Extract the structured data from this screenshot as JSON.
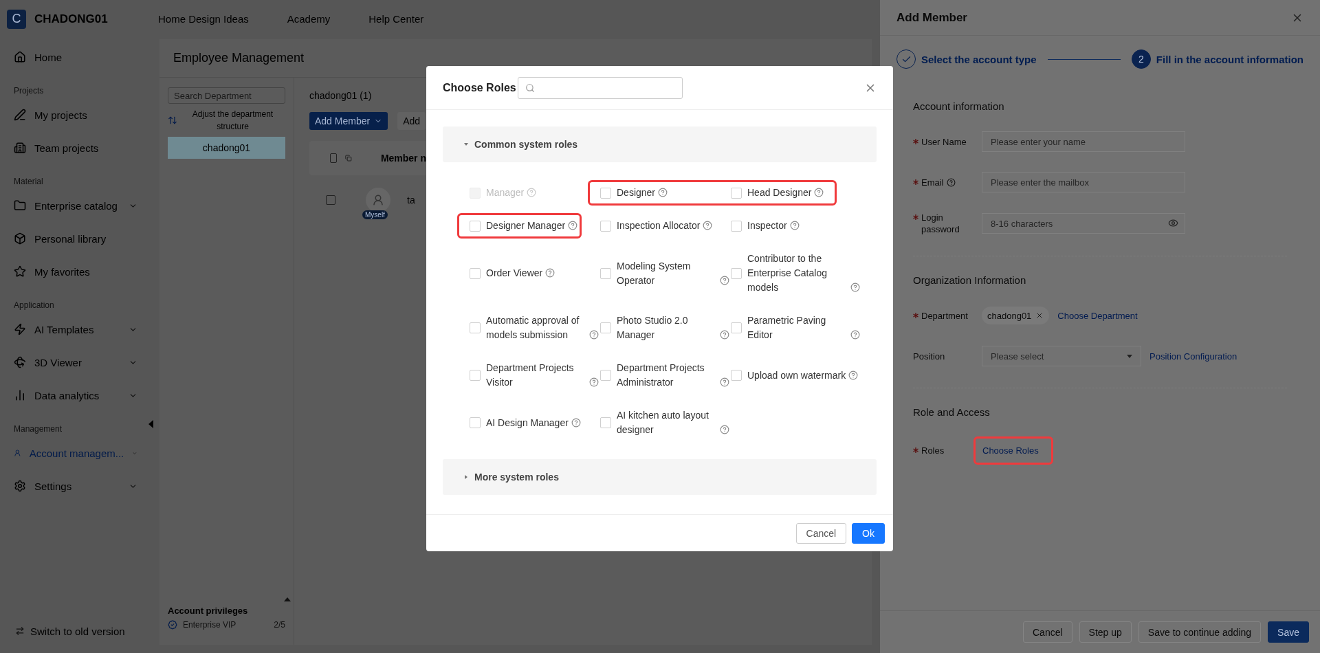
{
  "topbar": {
    "logo_letter": "C",
    "workspace": "CHADONG01",
    "nav": [
      {
        "label": "Home Design Ideas"
      },
      {
        "label": "Academy"
      },
      {
        "label": "Help Center"
      }
    ]
  },
  "sidebar": {
    "items": [
      {
        "kind": "item",
        "label": "Home",
        "expandable": false,
        "selected": false
      },
      {
        "kind": "section",
        "label": "Projects"
      },
      {
        "kind": "item",
        "label": "My projects",
        "expandable": false,
        "selected": false
      },
      {
        "kind": "item",
        "label": "Team projects",
        "expandable": false,
        "selected": false
      },
      {
        "kind": "section",
        "label": "Material"
      },
      {
        "kind": "item",
        "label": "Enterprise catalog",
        "expandable": true,
        "selected": false
      },
      {
        "kind": "item",
        "label": "Personal library",
        "expandable": false,
        "selected": false
      },
      {
        "kind": "item",
        "label": "My favorites",
        "expandable": false,
        "selected": false
      },
      {
        "kind": "section",
        "label": "Application"
      },
      {
        "kind": "item",
        "label": "AI Templates",
        "expandable": true,
        "selected": false
      },
      {
        "kind": "item",
        "label": "3D Viewer",
        "expandable": true,
        "selected": false
      },
      {
        "kind": "item",
        "label": "Data analytics",
        "expandable": true,
        "selected": false
      },
      {
        "kind": "section",
        "label": "Management"
      },
      {
        "kind": "item",
        "label": "Account managem...",
        "expandable": true,
        "selected": true
      },
      {
        "kind": "item",
        "label": "Settings",
        "expandable": true,
        "selected": false
      }
    ],
    "footer": "Switch to old version"
  },
  "page": {
    "title": "Employee Management",
    "department_search": {
      "placeholder": "Search Department"
    },
    "adjust_label": "Adjust the department structure",
    "departments": [
      {
        "label": "chadong01",
        "selected": true
      }
    ],
    "member_heading": "chadong01 (1)",
    "add_member_button": "Add Member",
    "add_button": "Add",
    "table": {
      "all_checked": false,
      "columns": [
        "Member n"
      ],
      "rows": [
        {
          "checked": false,
          "badge": "Myself",
          "name": "ta"
        }
      ]
    },
    "privileges": {
      "title": "Account privileges",
      "plan": "Enterprise VIP",
      "count": "2/5"
    }
  },
  "modal": {
    "title": "Choose Roles",
    "groups": [
      {
        "title": "Common system roles",
        "expanded": true,
        "roles": [
          {
            "label": "Manager",
            "checked": false,
            "disabled": true,
            "highlighted": false
          },
          {
            "label": "Designer",
            "checked": false,
            "disabled": false,
            "highlighted": true
          },
          {
            "label": "Head Designer",
            "checked": false,
            "disabled": false,
            "highlighted": true
          },
          {
            "label": "Designer Manager",
            "checked": false,
            "disabled": false,
            "highlighted": true
          },
          {
            "label": "Inspection Allocator",
            "checked": false,
            "disabled": false,
            "highlighted": false
          },
          {
            "label": "Inspector",
            "checked": false,
            "disabled": false,
            "highlighted": false
          },
          {
            "label": "Order Viewer",
            "checked": false,
            "disabled": false,
            "highlighted": false
          },
          {
            "label": "Modeling System Operator",
            "checked": false,
            "disabled": false,
            "highlighted": false
          },
          {
            "label": "Contributor to the Enterprise Catalog models",
            "checked": false,
            "disabled": false,
            "highlighted": false
          },
          {
            "label": "Automatic approval of models submission",
            "checked": false,
            "disabled": false,
            "highlighted": false
          },
          {
            "label": "Photo Studio 2.0 Manager",
            "checked": false,
            "disabled": false,
            "highlighted": false
          },
          {
            "label": "Parametric Paving Editor",
            "checked": false,
            "disabled": false,
            "highlighted": false
          },
          {
            "label": "Department Projects Visitor",
            "checked": false,
            "disabled": false,
            "highlighted": false
          },
          {
            "label": "Department Projects Administrator",
            "checked": false,
            "disabled": false,
            "highlighted": false
          },
          {
            "label": "Upload own watermark",
            "checked": false,
            "disabled": false,
            "highlighted": false
          },
          {
            "label": "AI Design Manager",
            "checked": false,
            "disabled": false,
            "highlighted": false
          },
          {
            "label": "AI kitchen auto layout designer",
            "checked": false,
            "disabled": false,
            "highlighted": false
          }
        ]
      },
      {
        "title": "More system roles",
        "expanded": false
      }
    ],
    "buttons": [
      {
        "label": "Cancel",
        "kind": "default"
      },
      {
        "label": "Ok",
        "kind": "primary"
      }
    ]
  },
  "drawer": {
    "title": "Add Member",
    "steps": [
      {
        "label": "Select the account type",
        "finished": true
      },
      {
        "number": "2",
        "label": "Fill in the account information",
        "finished": false
      }
    ],
    "sections": [
      {
        "title": "Account information",
        "fields": [
          {
            "kind": "input",
            "label": "User Name",
            "required": true,
            "help": false,
            "placeholder": "Please enter your name"
          },
          {
            "kind": "input",
            "label": "Email",
            "required": true,
            "help": true,
            "placeholder": "Please enter the mailbox"
          },
          {
            "kind": "password",
            "label": "Login password",
            "required": true,
            "help": false,
            "placeholder": "8-16 characters"
          }
        ]
      },
      {
        "title": "Organization Information",
        "fields": [
          {
            "kind": "tags",
            "label": "Department",
            "required": true,
            "help": false,
            "tags": [
              "chadong01"
            ],
            "link": "Choose Department"
          },
          {
            "kind": "select",
            "label": "Position",
            "required": false,
            "help": false,
            "placeholder": "Please select",
            "link": "Position Configuration"
          }
        ]
      },
      {
        "title": "Role and Access",
        "fields": [
          {
            "kind": "link",
            "label": "Roles",
            "required": true,
            "help": false,
            "link": "Choose Roles",
            "highlighted": true
          }
        ]
      }
    ],
    "buttons": [
      {
        "label": "Cancel",
        "kind": "default"
      },
      {
        "label": "Step up",
        "kind": "default"
      },
      {
        "label": "Save to continue adding",
        "kind": "default"
      },
      {
        "label": "Save",
        "kind": "primary"
      }
    ]
  }
}
